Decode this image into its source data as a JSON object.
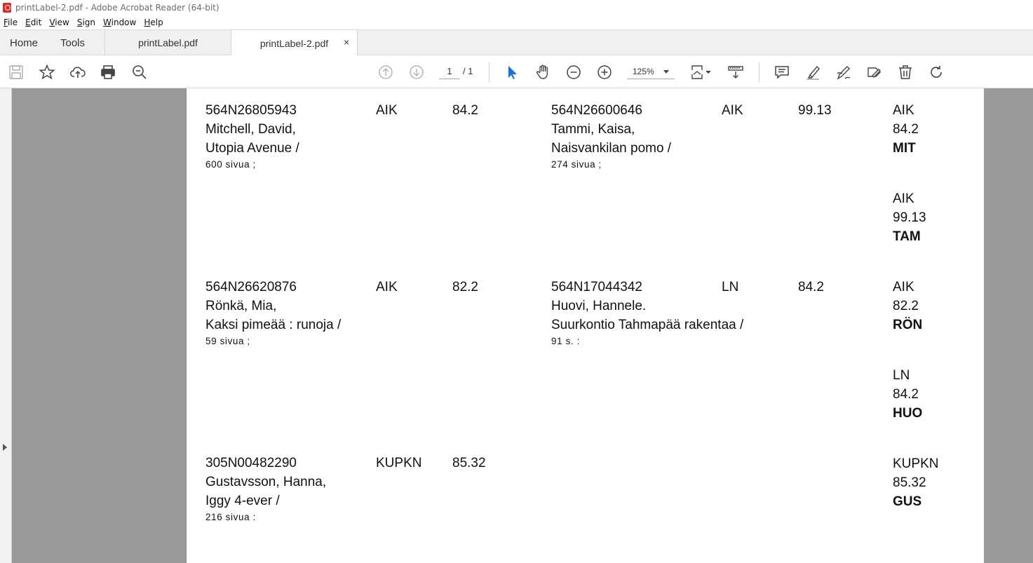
{
  "window": {
    "title": "printLabel-2.pdf - Adobe Acrobat Reader (64-bit)"
  },
  "menu": [
    "File",
    "Edit",
    "View",
    "Sign",
    "Window",
    "Help"
  ],
  "tabs": {
    "home": "Home",
    "tools": "Tools",
    "doc1": "printLabel.pdf",
    "doc2": "printLabel-2.pdf",
    "close": "×"
  },
  "toolbar": {
    "page_current": "1",
    "page_total": "/ 1",
    "zoom": "125%"
  },
  "icons": [
    "save-icon",
    "star-icon",
    "upload-icon",
    "print-icon",
    "zoom-search-icon",
    "page-up-icon",
    "page-down-icon",
    "select-cursor-icon",
    "hand-icon",
    "zoom-out-icon",
    "zoom-in-icon",
    "page-fit-icon",
    "scroll-mode-icon",
    "comment-icon",
    "highlight-icon",
    "draw-icon",
    "fill-sign-icon",
    "delete-icon",
    "rotate-icon"
  ],
  "colors": {
    "accent": "#1473e6",
    "tab_bg": "#f0f0f0",
    "workspace": "#9a9a9a"
  },
  "records": [
    {
      "id": "564N26805943",
      "author": "Mitchell, David,",
      "title": "Utopia Avenue /",
      "pages": "600 sivua ;",
      "loc": "AIK",
      "class": "84.2"
    },
    {
      "id": "564N26600646",
      "author": "Tammi, Kaisa,",
      "title": "Naisvankilan pomo /",
      "pages": "274 sivua ;",
      "loc": "AIK",
      "class": "99.13"
    },
    {
      "id": "564N26620876",
      "author": "Rönkä, Mia,",
      "title": "Kaksi pimeää : runoja /",
      "pages": "59 sivua ;",
      "loc": "AIK",
      "class": "82.2"
    },
    {
      "id": "564N17044342",
      "author": "Huovi, Hannele.",
      "title": "Suurkontio Tahmapää rakentaa /",
      "pages": "91 s. :",
      "loc": "LN",
      "class": "84.2"
    },
    {
      "id": "305N00482290",
      "author": "Gustavsson, Hanna,",
      "title": "Iggy 4-ever /",
      "pages": "216 sivua :",
      "loc": "KUPKN",
      "class": "85.32"
    }
  ],
  "labels": [
    {
      "loc": "AIK",
      "class": "84.2",
      "code": "MIT"
    },
    {
      "loc": "AIK",
      "class": "99.13",
      "code": "TAM"
    },
    {
      "loc": "AIK",
      "class": "82.2",
      "code": "RÖN"
    },
    {
      "loc": "LN",
      "class": "84.2",
      "code": "HUO"
    },
    {
      "loc": "KUPKN",
      "class": "85.32",
      "code": "GUS"
    }
  ]
}
